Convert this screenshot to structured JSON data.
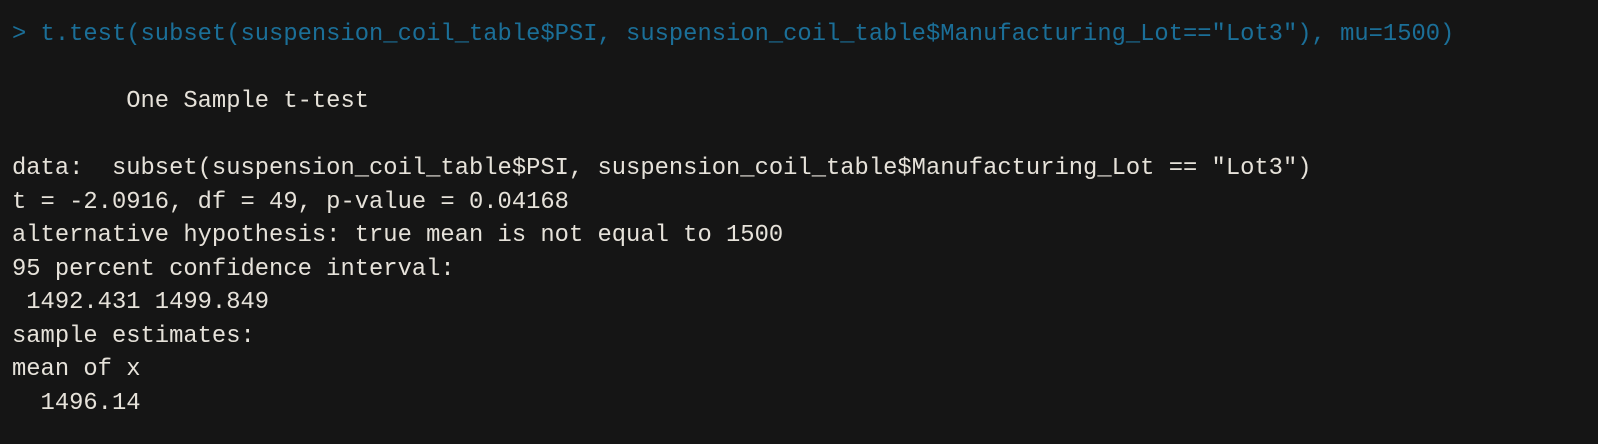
{
  "console": {
    "command": "> t.test(subset(suspension_coil_table$PSI, suspension_coil_table$Manufacturing_Lot==\"Lot3\"), mu=1500)",
    "output": [
      "",
      "        One Sample t-test",
      "",
      "data:  subset(suspension_coil_table$PSI, suspension_coil_table$Manufacturing_Lot == \"Lot3\")",
      "t = -2.0916, df = 49, p-value = 0.04168",
      "alternative hypothesis: true mean is not equal to 1500",
      "95 percent confidence interval:",
      " 1492.431 1499.849",
      "sample estimates:",
      "mean of x ",
      "  1496.14 "
    ]
  },
  "colors": {
    "background": "#151515",
    "command": "#1b6f98",
    "output": "#e6e2da"
  }
}
